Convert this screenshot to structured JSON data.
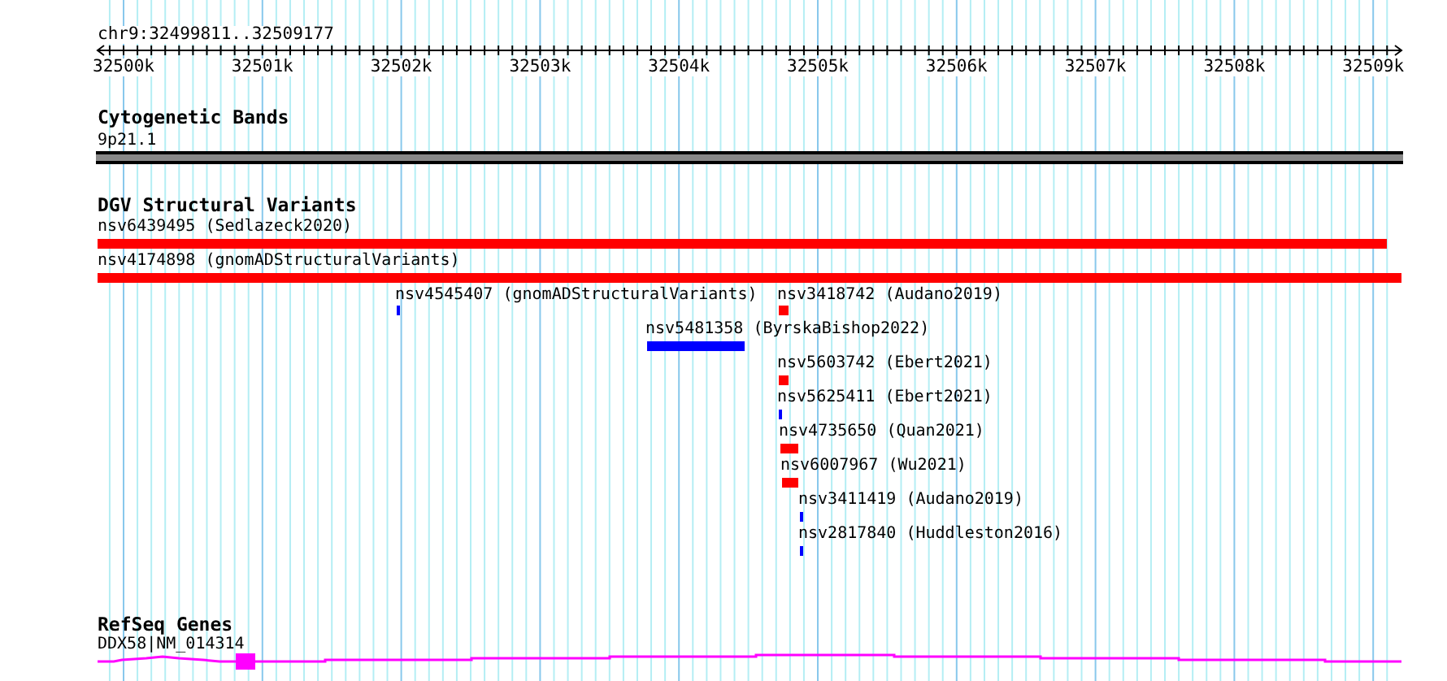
{
  "location": "chr9:32499811..32509177",
  "ruler": {
    "ticks": [
      "32500k",
      "32501k",
      "32502k",
      "32503k",
      "32504k",
      "32505k",
      "32506k",
      "32507k",
      "32508k",
      "32509k"
    ]
  },
  "tracks": [
    {
      "kind": "bands",
      "title": "Cytogenetic Bands",
      "features": [
        {
          "label": "9p21.1"
        }
      ]
    },
    {
      "kind": "variants",
      "title": "DGV Structural Variants",
      "features": [
        {
          "label": "nsv6439495 (Sedlazeck2020)",
          "color": "#ff0000"
        },
        {
          "label": "nsv4174898 (gnomADStructuralVariants)",
          "color": "#ff0000"
        },
        {
          "label": "nsv4545407 (gnomADStructuralVariants)",
          "color": "#0000ff"
        },
        {
          "label": "nsv3418742 (Audano2019)",
          "color": "#ff0000"
        },
        {
          "label": "nsv5481358 (ByrskaBishop2022)",
          "color": "#0000ff"
        },
        {
          "label": "nsv5603742 (Ebert2021)",
          "color": "#ff0000"
        },
        {
          "label": "nsv5625411 (Ebert2021)",
          "color": "#0000ff"
        },
        {
          "label": "nsv4735650 (Quan2021)",
          "color": "#ff0000"
        },
        {
          "label": "nsv6007967 (Wu2021)",
          "color": "#ff0000"
        },
        {
          "label": "nsv3411419 (Audano2019)",
          "color": "#0000ff"
        },
        {
          "label": "nsv2817840 (Huddleston2016)",
          "color": "#0000ff"
        }
      ]
    },
    {
      "kind": "genes",
      "title": "RefSeq Genes",
      "features": [
        {
          "label": "DDX58|NM_014314"
        }
      ]
    }
  ]
}
